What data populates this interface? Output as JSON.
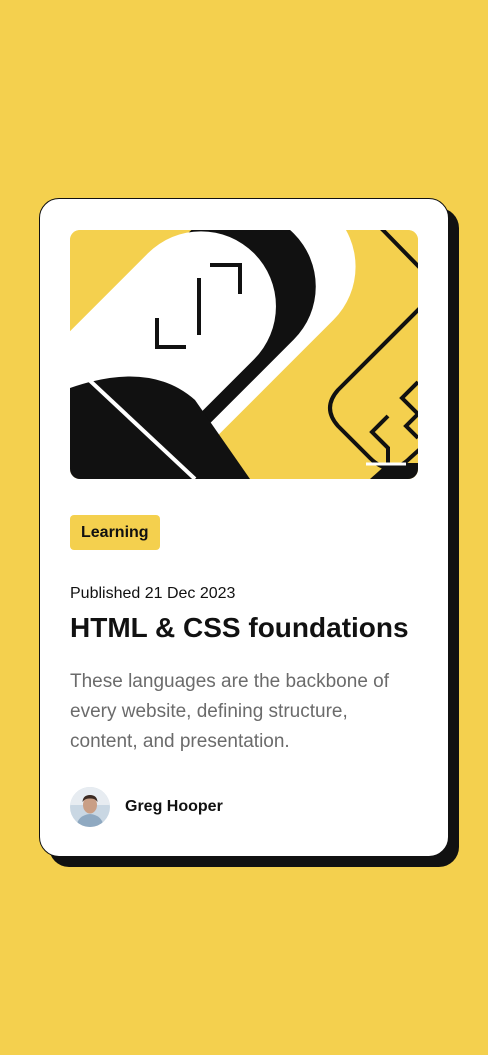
{
  "card": {
    "hero_image": "illustration-article",
    "category": "Learning",
    "published": "Published 21 Dec 2023",
    "title": "HTML & CSS foundations",
    "description": "These languages are the backbone of every website, defining structure, content, and presentation.",
    "author": {
      "name": "Greg Hooper",
      "avatar": "avatar-photo"
    }
  },
  "colors": {
    "background": "#f4d04e",
    "card": "#ffffff",
    "ink": "#111111",
    "muted_text": "#6b6b6b",
    "tag_background": "#f4d04e"
  }
}
